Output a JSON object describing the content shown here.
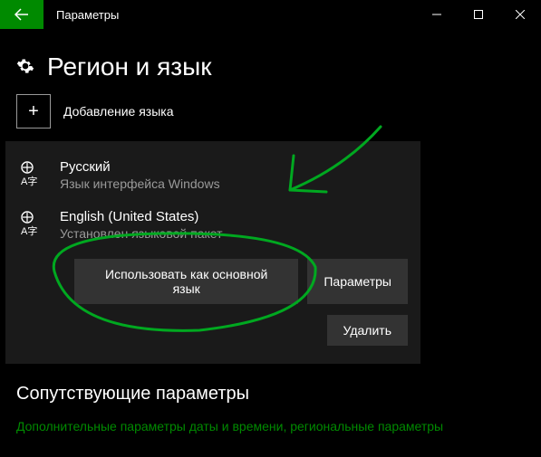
{
  "titlebar": {
    "title": "Параметры"
  },
  "page": {
    "heading": "Регион и язык",
    "add_language": "Добавление языка"
  },
  "languages": [
    {
      "name": "Русский",
      "subtitle": "Язык интерфейса Windows"
    },
    {
      "name": "English (United States)",
      "subtitle": "Установлен языковой пакет"
    }
  ],
  "buttons": {
    "set_default": "Использовать как основной язык",
    "options": "Параметры",
    "remove": "Удалить"
  },
  "related": {
    "heading": "Сопутствующие параметры",
    "link": "Дополнительные параметры даты и времени, региональные параметры"
  }
}
